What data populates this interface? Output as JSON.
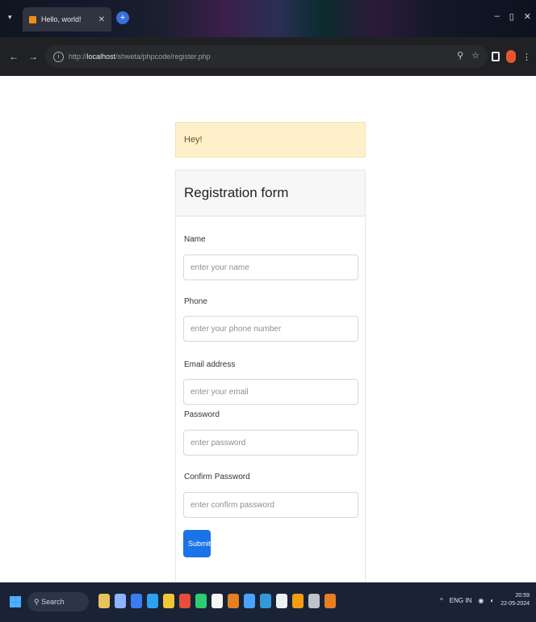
{
  "browser": {
    "tab_title": "Hello, world!",
    "tab_close": "✕",
    "tab_menu": "▾",
    "new_tab": "+",
    "url_prefix": "http://",
    "url_host": "localhost",
    "url_path": "/shweta/phpcode/register.php",
    "window_minimize": "–",
    "window_restore": "▯",
    "window_close": "✕"
  },
  "alert": {
    "text": "Hey!"
  },
  "form": {
    "title": "Registration form",
    "fields": [
      {
        "label": "Name",
        "placeholder": "enter your name",
        "value": ""
      },
      {
        "label": "Phone",
        "placeholder": "enter your phone number",
        "value": ""
      },
      {
        "label": "Email address",
        "placeholder": "enter your email",
        "value": ""
      },
      {
        "label": "Password",
        "placeholder": "enter password",
        "value": ""
      },
      {
        "label": "Confirm Password",
        "placeholder": "enter confirm password",
        "value": ""
      }
    ],
    "submit_label": "Submit"
  },
  "taskbar": {
    "search_label": "Search",
    "tray_lang": "ENG IN",
    "time": "20:59",
    "date": "22-05-2024"
  },
  "colors": {
    "primary": "#1a73e8",
    "alert_bg": "#fdf0cb",
    "taskbar_bg": "#1a2336"
  }
}
